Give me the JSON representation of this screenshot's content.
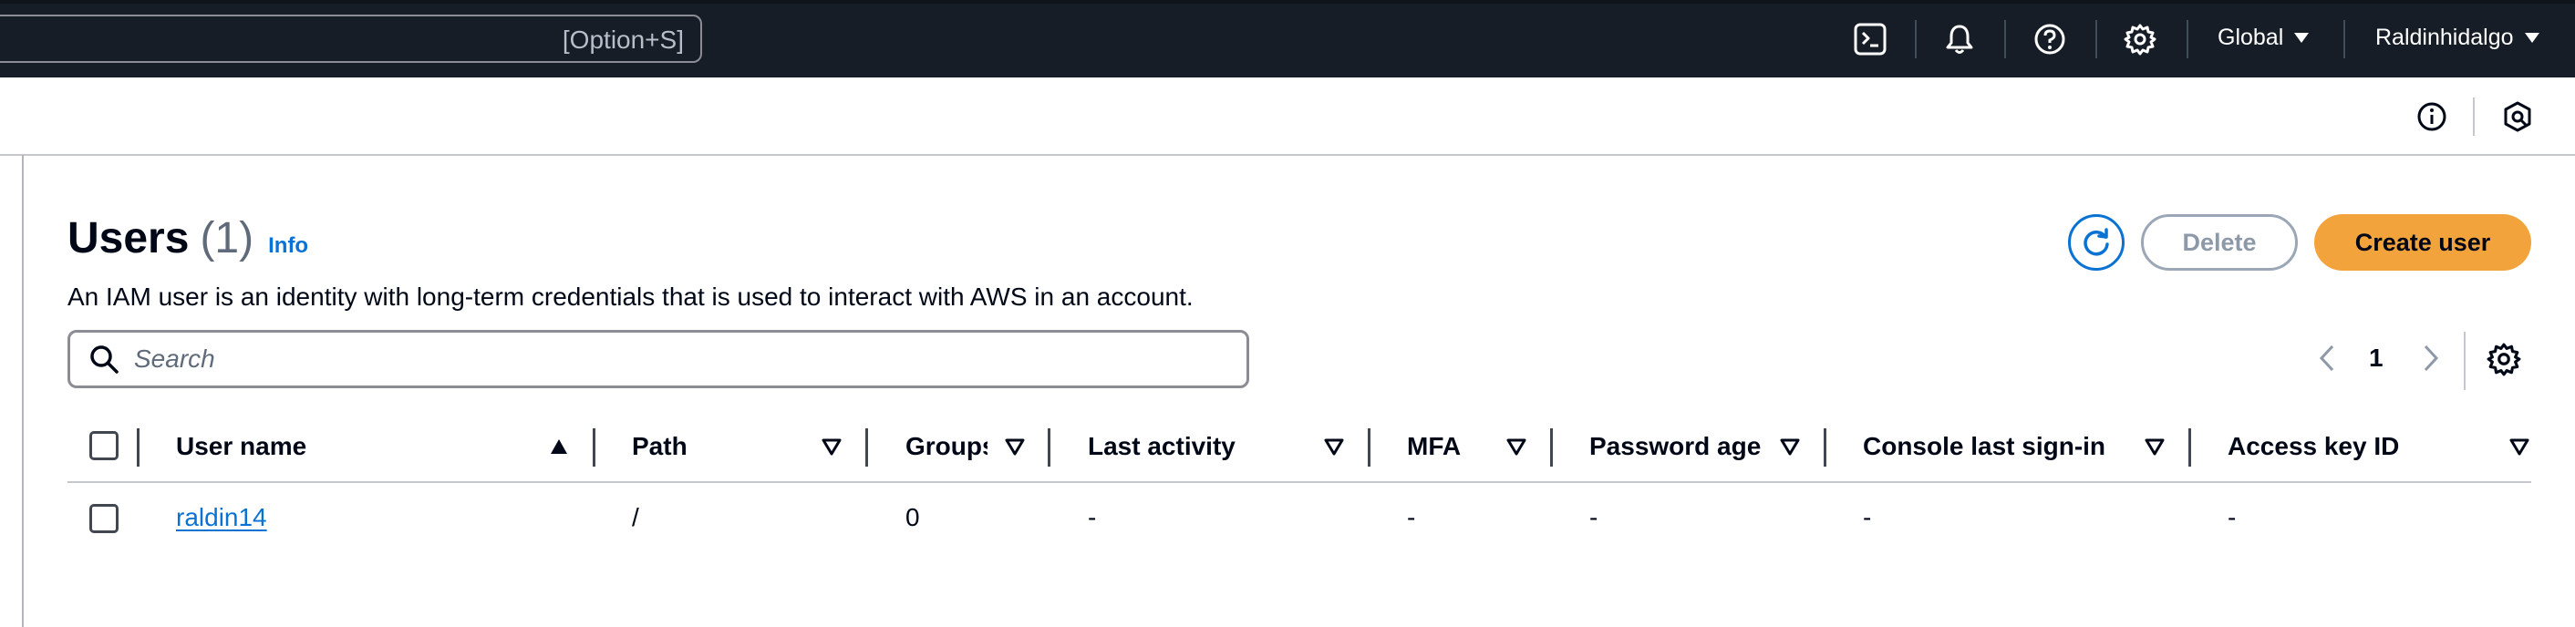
{
  "topnav": {
    "search_shortcut": "[Option+S]",
    "icons": [
      "cloudshell-icon",
      "bell-icon",
      "help-icon",
      "gear-icon"
    ],
    "region": "Global",
    "account": "Raldinhidalgo"
  },
  "subbar": {
    "icons": [
      "info-icon",
      "panel-icon"
    ]
  },
  "header": {
    "title": "Users",
    "count": "(1)",
    "info": "Info",
    "description": "An IAM user is an identity with long-term credentials that is used to interact with AWS in an account."
  },
  "actions": {
    "delete": "Delete",
    "create": "Create user"
  },
  "search": {
    "placeholder": "Search"
  },
  "pagination": {
    "current_page": "1"
  },
  "table": {
    "columns": [
      "User name",
      "Path",
      "Groups",
      "Last activity",
      "MFA",
      "Password age",
      "Console last sign-in",
      "Access key ID"
    ],
    "rows": [
      {
        "user_name": "raldin14",
        "path": "/",
        "groups": "0",
        "last_activity": "-",
        "mfa": "-",
        "password_age": "-",
        "console_last_sign_in": "-",
        "access_key_id": "-"
      }
    ]
  },
  "colors": {
    "nav_bg": "#161d26",
    "link": "#0972d3",
    "primary_button": "#f3a33c",
    "disabled": "#8d99a8"
  }
}
